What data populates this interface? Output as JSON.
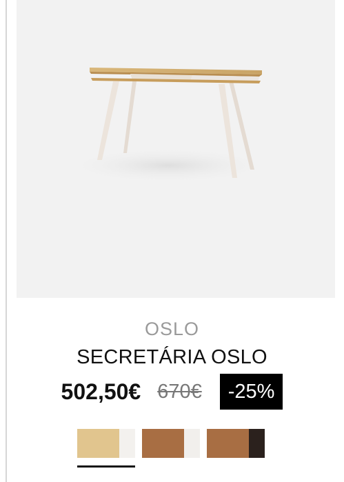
{
  "product": {
    "brand": "OSLO",
    "title": "SECRETÁRIA OSLO",
    "price_current": "502,50€",
    "price_old": "670€",
    "discount_badge": "-25%",
    "image_alt": "desk-image"
  },
  "swatches": [
    {
      "wood_color": "#e1c58e",
      "tone_color": "#f3f1ee",
      "selected": true
    },
    {
      "wood_color": "#a86e43",
      "tone_color": "#f1efec",
      "selected": false
    },
    {
      "wood_color": "#a86e43",
      "tone_color": "#2b211d",
      "selected": false
    }
  ],
  "colors": {
    "image_background": "#f2f2f2",
    "brand_text": "#9a9a9a",
    "badge_background": "#000000",
    "badge_text": "#ffffff"
  }
}
